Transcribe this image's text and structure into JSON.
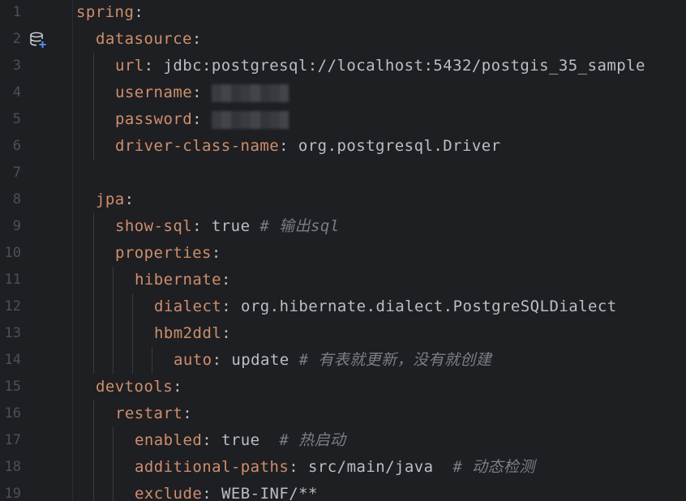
{
  "editor": {
    "lines": [
      {
        "n": "1",
        "indent": 0,
        "key": "spring",
        "sep": ":",
        "value": "",
        "comment": ""
      },
      {
        "n": "2",
        "indent": 1,
        "key": "datasource",
        "sep": ":",
        "value": "",
        "comment": ""
      },
      {
        "n": "3",
        "indent": 2,
        "key": "url",
        "sep": ":",
        "value": " jdbc:postgresql://localhost:5432/postgis_35_sample",
        "comment": ""
      },
      {
        "n": "4",
        "indent": 2,
        "key": "username",
        "sep": ":",
        "value": " ",
        "comment": "",
        "redacted": true
      },
      {
        "n": "5",
        "indent": 2,
        "key": "password",
        "sep": ":",
        "value": " ",
        "comment": "",
        "redacted": true
      },
      {
        "n": "6",
        "indent": 2,
        "key": "driver-class-name",
        "sep": ":",
        "value": " org.postgresql.Driver",
        "comment": ""
      },
      {
        "n": "7",
        "indent": 0,
        "key": "",
        "sep": "",
        "value": "",
        "comment": ""
      },
      {
        "n": "8",
        "indent": 1,
        "key": "jpa",
        "sep": ":",
        "value": "",
        "comment": ""
      },
      {
        "n": "9",
        "indent": 2,
        "key": "show-sql",
        "sep": ":",
        "value": " true ",
        "comment": "# 输出sql"
      },
      {
        "n": "10",
        "indent": 2,
        "key": "properties",
        "sep": ":",
        "value": "",
        "comment": ""
      },
      {
        "n": "11",
        "indent": 3,
        "key": "hibernate",
        "sep": ":",
        "value": "",
        "comment": ""
      },
      {
        "n": "12",
        "indent": 4,
        "key": "dialect",
        "sep": ":",
        "value": " org.hibernate.dialect.PostgreSQLDialect",
        "comment": ""
      },
      {
        "n": "13",
        "indent": 4,
        "key": "hbm2ddl",
        "sep": ":",
        "value": "",
        "comment": ""
      },
      {
        "n": "14",
        "indent": 5,
        "key": "auto",
        "sep": ":",
        "value": " update ",
        "comment": "# 有表就更新，没有就创建"
      },
      {
        "n": "15",
        "indent": 1,
        "key": "devtools",
        "sep": ":",
        "value": "",
        "comment": ""
      },
      {
        "n": "16",
        "indent": 2,
        "key": "restart",
        "sep": ":",
        "value": "",
        "comment": ""
      },
      {
        "n": "17",
        "indent": 3,
        "key": "enabled",
        "sep": ":",
        "value": " true  ",
        "comment": "# 热启动"
      },
      {
        "n": "18",
        "indent": 3,
        "key": "additional-paths",
        "sep": ":",
        "value": " src/main/java  ",
        "comment": "# 动态检测"
      },
      {
        "n": "19",
        "indent": 3,
        "key": "exclude",
        "sep": ":",
        "value": " WEB-INF/**",
        "comment": ""
      }
    ],
    "gutter_icon_line": "2",
    "gutter_icon": "database-add-icon"
  },
  "colors": {
    "background": "#1e1f22",
    "key": "#cf8e6d",
    "text": "#bcbec4",
    "comment": "#7a7e85",
    "line_number": "#4b5059"
  }
}
